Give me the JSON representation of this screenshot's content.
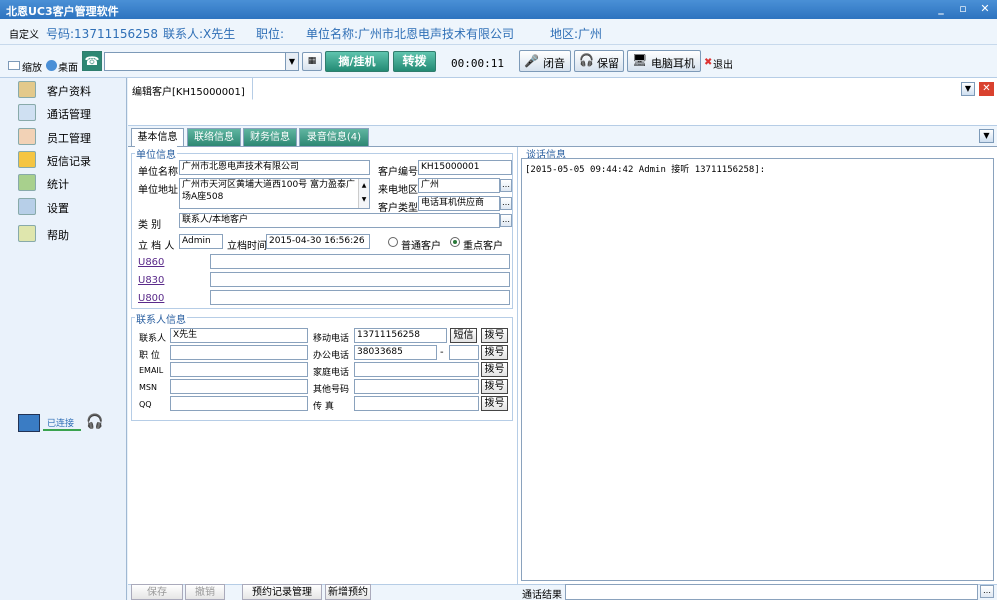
{
  "window": {
    "title": "北恩UC3客户管理软件"
  },
  "infobar": {
    "custom": "自定义",
    "phone": "号码:13711156258",
    "contact": "联系人:X先生",
    "position": "职位:",
    "company": "单位名称:广州市北恩电声技术有限公司",
    "region": "地区:广州"
  },
  "toolbar": {
    "minimize_label": "缩放",
    "desktop_label": "桌面",
    "dial_value": "",
    "pickup_label": "摘/挂机",
    "transfer_label": "转拨",
    "timer": "00:00:11",
    "mute_label": "闭音",
    "hold_label": "保留",
    "headset_label": "电脑耳机",
    "exit_label": "退出"
  },
  "sidebar": {
    "items": [
      {
        "label": "客户资料",
        "icon": "contact-card-icon"
      },
      {
        "label": "通话管理",
        "icon": "call-icon"
      },
      {
        "label": "员工管理",
        "icon": "users-icon"
      },
      {
        "label": "短信记录",
        "icon": "envelope-icon"
      },
      {
        "label": "统计",
        "icon": "bar-chart-icon"
      },
      {
        "label": "设置",
        "icon": "settings-icon"
      },
      {
        "label": "帮助",
        "icon": "help-icon"
      }
    ],
    "connection_status": "已连接"
  },
  "doc_tab": {
    "label": "编辑客户[KH15000001]"
  },
  "tabs": [
    {
      "label": "基本信息"
    },
    {
      "label": "联络信息"
    },
    {
      "label": "财务信息"
    },
    {
      "label": "录音信息(4)"
    }
  ],
  "company_section": {
    "title": "单位信息",
    "name_label": "单位名称",
    "name_value": "广州市北恩电声技术有限公司",
    "cust_no_label": "客户编号",
    "cust_no_value": "KH15000001",
    "address_label": "单位地址",
    "address_value": "广州市天河区黄埔大道西100号 富力盈泰广场A座508",
    "area_label": "来电地区",
    "area_value": "广州",
    "type_label": "客户类型",
    "type_value": "电话耳机供应商",
    "category_label": "类   别",
    "category_value": "联系人/本地客户",
    "creator_label": "立 档 人",
    "creator_value": "Admin",
    "created_label": "立档时间",
    "created_value": "2015-04-30 16:56:26",
    "normal_label": "普通客户",
    "key_label": "重点客户",
    "links": [
      "U860",
      "U830",
      "U800"
    ]
  },
  "contact_section": {
    "title": "联系人信息",
    "rows": [
      {
        "left_label": "联系人",
        "left_value": "X先生",
        "right_label": "移动电话",
        "right_value": "13711156258"
      },
      {
        "left_label": "职  位",
        "left_value": "",
        "right_label": "办公电话",
        "right_value": "38033685"
      },
      {
        "left_label": "EMAIL",
        "left_value": "",
        "right_label": "家庭电话",
        "right_value": ""
      },
      {
        "left_label": "MSN",
        "left_value": "",
        "right_label": "其他号码",
        "right_value": ""
      },
      {
        "left_label": "QQ",
        "left_value": "",
        "right_label": "传    真",
        "right_value": ""
      }
    ],
    "sms_label": "短信",
    "dial_label": "拨号",
    "dash": "-"
  },
  "talk_section": {
    "title": "谈话信息",
    "log": "[2015-05-05 09:44:42 Admin 接听  13711156258]:",
    "result_label": "通话结果",
    "result_value": ""
  },
  "bottom": {
    "save": "保存",
    "cancel": "撤销",
    "appointments": "预约记录管理",
    "new_appointment": "新增预约"
  },
  "colors": {
    "accent": "#2f6fb6",
    "green": "#238a74",
    "title": "#2d73bf"
  }
}
